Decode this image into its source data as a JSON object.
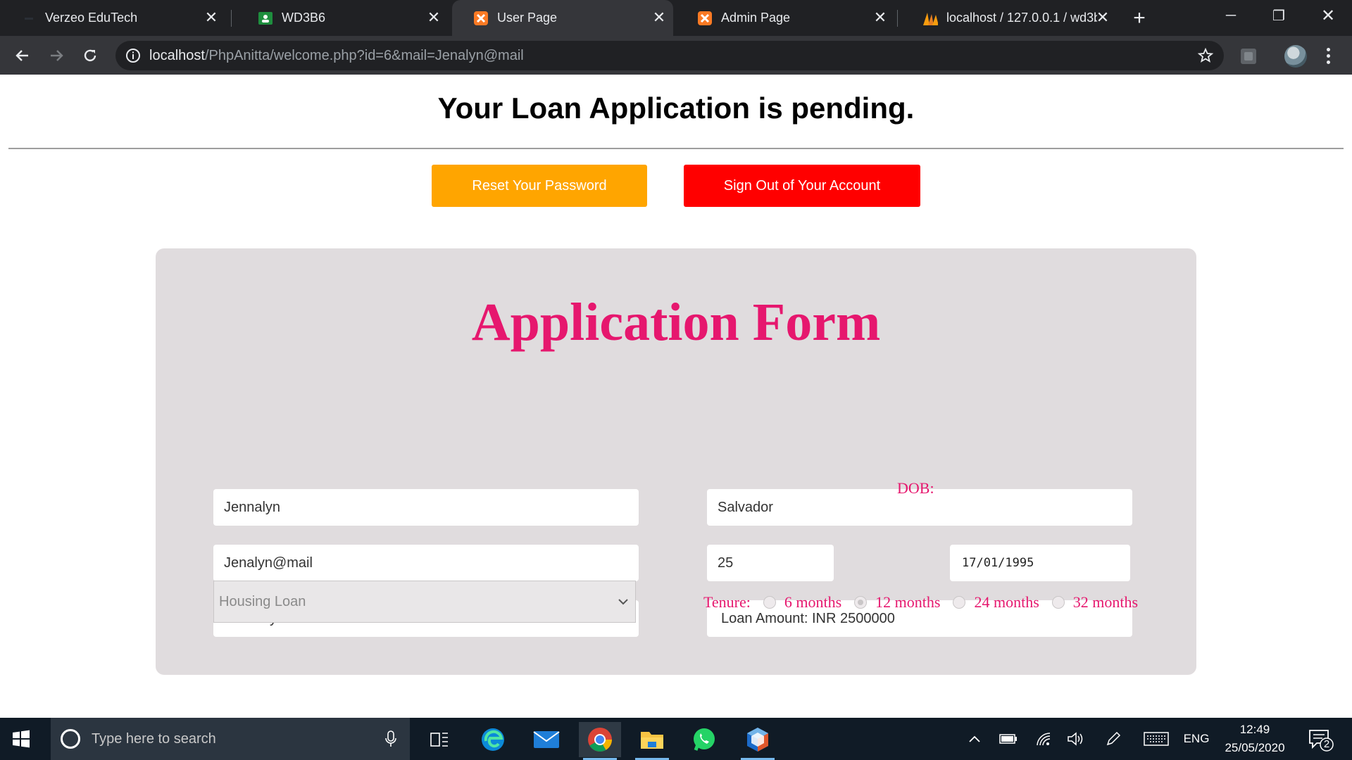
{
  "browser": {
    "tabs": [
      {
        "label": "Verzeo EduTech",
        "icon": "verzeo-favicon"
      },
      {
        "label": "WD3B6",
        "icon": "google-classroom-favicon"
      },
      {
        "label": "User Page",
        "icon": "xampp-favicon",
        "active": true
      },
      {
        "label": "Admin Page",
        "icon": "xampp-favicon"
      },
      {
        "label": "localhost / 127.0.0.1 / wd3b",
        "icon": "phpmyadmin-favicon"
      }
    ],
    "url_host": "localhost",
    "url_path": "/PhpAnitta/welcome.php?id=6&mail=Jenalyn@mail"
  },
  "page": {
    "heading": "Your Loan Application is pending.",
    "reset_button": "Reset Your Password",
    "signout_button": "Sign Out of Your Account",
    "colors": {
      "reset": "#ffa500",
      "signout": "#ff0000",
      "accent": "#e6176e",
      "form_bg": "#e0dcde"
    },
    "form": {
      "title": "Application Form",
      "first_name": "Jennalyn",
      "last_name": "Salvador",
      "email": "Jenalyn@mail",
      "age": "25",
      "dob_label": "DOB:",
      "dob": "17/01/1995",
      "monthly_income": "Monthly Income: INR 50000",
      "loan_amount": "Loan Amount: INR 2500000",
      "loan_type": "Housing Loan",
      "tenure_label": "Tenure:",
      "tenure_options": [
        "6 months",
        "12 months",
        "24 months",
        "32 months"
      ],
      "tenure_selected": "12 months"
    }
  },
  "taskbar": {
    "search_placeholder": "Type here to search",
    "language": "ENG",
    "time": "12:49",
    "date": "25/05/2020",
    "notification_count": "2"
  }
}
